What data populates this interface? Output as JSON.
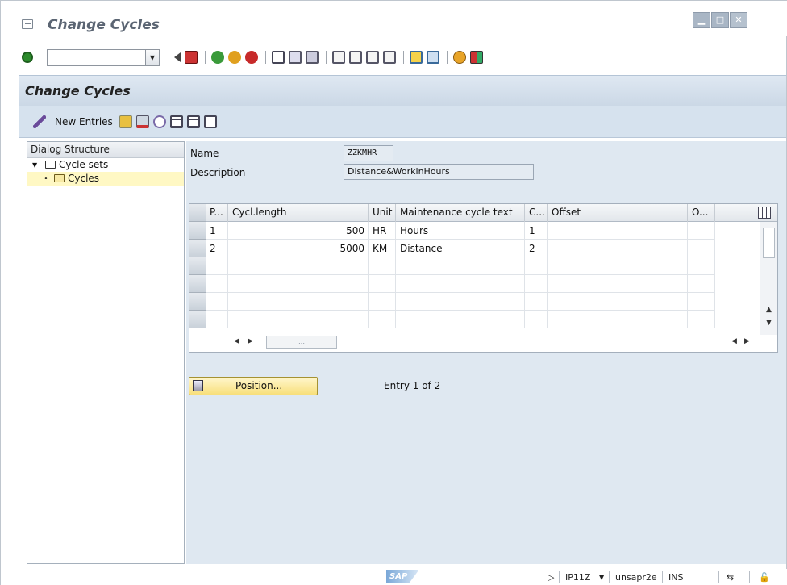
{
  "window": {
    "title": "Change Cycles",
    "controls": [
      "minimize",
      "maximize",
      "close"
    ]
  },
  "toolbar": {
    "command_field_value": "",
    "icons": [
      "enter-icon",
      "back-arrow-icon",
      "save-icon",
      "back-icon",
      "exit-icon",
      "cancel-icon",
      "print-icon",
      "find-icon",
      "find-next-icon",
      "first-page-icon",
      "previous-page-icon",
      "next-page-icon",
      "last-page-icon",
      "create-session-icon",
      "shortcut-icon",
      "help-icon",
      "layout-icon"
    ]
  },
  "app": {
    "title": "Change Cycles",
    "new_entries_label": "New Entries"
  },
  "dialog_structure": {
    "header": "Dialog Structure",
    "items": [
      {
        "label": "Cycle sets",
        "expanded": true
      },
      {
        "label": "Cycles",
        "selected": true
      }
    ]
  },
  "form": {
    "name_label": "Name",
    "name_value": "ZZKMHR",
    "description_label": "Description",
    "description_value": "Distance&WorkinHours"
  },
  "table": {
    "columns": [
      "P...",
      "Cycl.length",
      "Unit",
      "Maintenance cycle text",
      "C...",
      "Offset",
      "O..."
    ],
    "rows": [
      {
        "p": "1",
        "cycl_length": "500",
        "unit": "HR",
        "text": "Hours",
        "c": "1",
        "offset": "",
        "o": ""
      },
      {
        "p": "2",
        "cycl_length": "5000",
        "unit": "KM",
        "text": "Distance",
        "c": "2",
        "offset": "",
        "o": ""
      }
    ],
    "empty_rows": 4
  },
  "position_button": "Position...",
  "entry_text": "Entry 1 of 2",
  "status": {
    "system": "IP11Z",
    "server": "unsapr2e",
    "mode": "INS",
    "logo": "SAP"
  }
}
